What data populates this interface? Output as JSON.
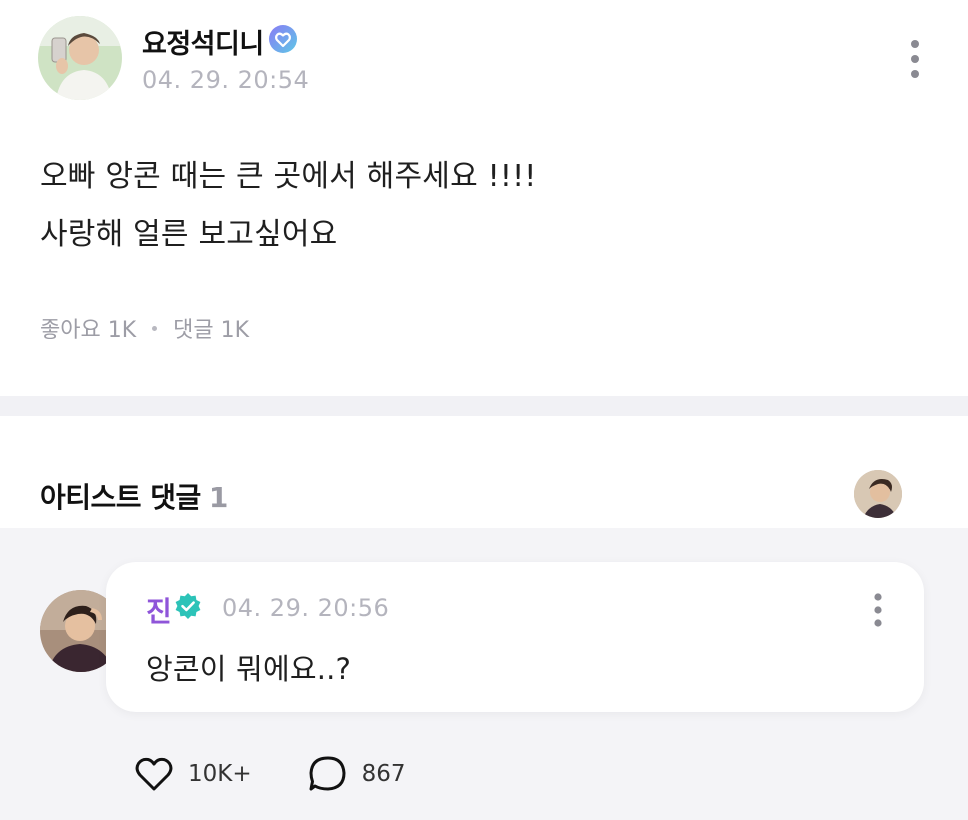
{
  "post": {
    "author": "요정석디니",
    "timestamp": "04. 29. 20:54",
    "body_lines": [
      "오빠 앙콘 때는 큰 곳에서 해주세요 !!!!",
      "사랑해 얼른 보고싶어요"
    ],
    "likes_label": "좋아요 1K",
    "comments_label": "댓글 1K",
    "avatar_icon": "user-photo-avatar",
    "badge_icon": "fan-heart-badge-icon",
    "more_icon": "more-vertical-icon"
  },
  "artist_comments": {
    "title": "아티스트 댓글",
    "count": "1",
    "avatar_icon": "artist-avatar"
  },
  "comment": {
    "author": "진",
    "timestamp": "04. 29. 20:56",
    "text": "앙콘이 뭐에요..?",
    "like_count": "10K+",
    "reply_count": "867",
    "avatar_icon": "artist-photo-avatar",
    "badge_icon": "verified-badge-icon",
    "like_icon": "heart-icon",
    "reply_icon": "comment-bubble-icon"
  },
  "colors": {
    "artist_name": "#8f55d9",
    "verified_badge": "#2cc3b8",
    "fan_badge": "#7b6cf0",
    "timestamp": "#b4b4bd",
    "divider": "#f1f1f5",
    "comment_background": "#f4f4f7"
  }
}
